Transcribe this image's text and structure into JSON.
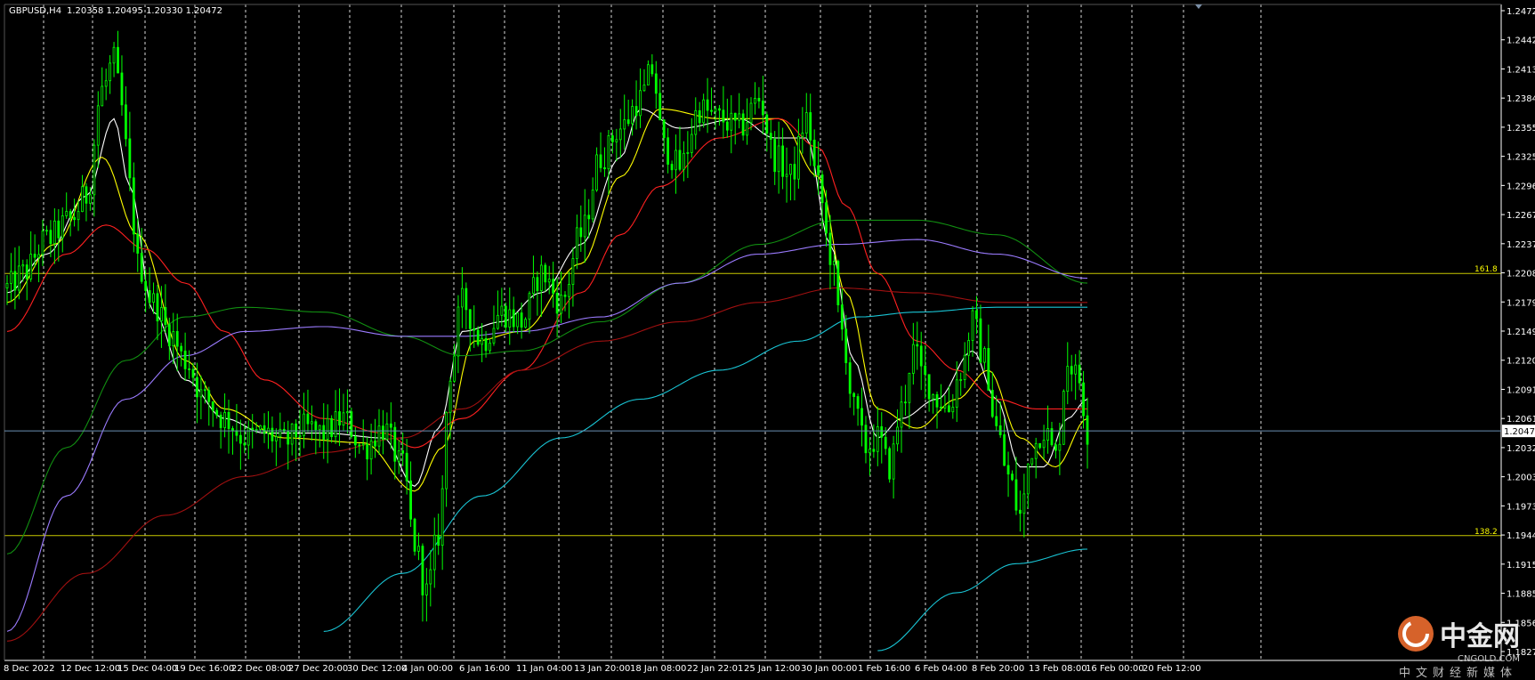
{
  "header": {
    "symbol": "GBPUSD,H4",
    "ohlc": "1.20358 1.20495 1.20330 1.20472"
  },
  "fib_levels": [
    {
      "label": "161.8",
      "price": 1.221
    },
    {
      "label": "138.2",
      "price": 1.1939
    }
  ],
  "current_price": {
    "label": "1.20472",
    "value": 1.20472
  },
  "logo": {
    "cn": "中金网",
    "en": "CNGOLD.COM",
    "sub": "中文财经新媒体"
  },
  "colors": {
    "background": "#000000",
    "candle": "#00ff00",
    "grid": "#ffffff",
    "axis": "#ffffff",
    "fib": "#c8c800",
    "current_line": "#6b8fb3",
    "ma_white": "#ffffff",
    "ma_yellow": "#ffff00",
    "ma_red": "#ff2020",
    "ma_darkred": "#a01010",
    "ma_green": "#118f11",
    "ma_purple": "#9b7bff",
    "ma_cyan": "#19c4d4"
  },
  "chart_data": {
    "type": "candlestick",
    "title": "GBPUSD,H4",
    "ylim": [
      1.181,
      1.2488
    ],
    "y_ticks": [
      "1.24720",
      "1.24425",
      "1.24130",
      "1.23840",
      "1.23550",
      "1.23255",
      "1.22960",
      "1.22670",
      "1.22375",
      "1.22080",
      "1.21790",
      "1.21495",
      "1.21200",
      "1.20910",
      "1.20615",
      "1.20323",
      "1.20030",
      "1.19735",
      "1.19445",
      "1.19150",
      "1.18855",
      "1.18565",
      "1.18270"
    ],
    "x_ticks": [
      "8 Dec 2022",
      "12 Dec 12:00",
      "15 Dec 04:00",
      "19 Dec 16:00",
      "22 Dec 08:00",
      "27 Dec 20:00",
      "30 Dec 12:00",
      "4 Jan 00:00",
      "6 Jan 16:00",
      "11 Jan 04:00",
      "13 Jan 20:00",
      "18 Jan 08:00",
      "22 Jan 22:01",
      "25 Jan 12:00",
      "30 Jan 00:00",
      "1 Feb 16:00",
      "6 Feb 04:00",
      "8 Feb 20:00",
      "13 Feb 08:00",
      "16 Feb 00:00",
      "20 Feb 12:00"
    ],
    "grid": true,
    "series_price_path": {
      "description_values": "approximate close anchors per bar index",
      "anchors": [
        [
          0,
          1.2195
        ],
        [
          4,
          1.221
        ],
        [
          10,
          1.2245
        ],
        [
          16,
          1.2265
        ],
        [
          20,
          1.229
        ],
        [
          24,
          1.24
        ],
        [
          27,
          1.243
        ],
        [
          29,
          1.238
        ],
        [
          31,
          1.23
        ],
        [
          33,
          1.222
        ],
        [
          37,
          1.218
        ],
        [
          41,
          1.215
        ],
        [
          45,
          1.212
        ],
        [
          50,
          1.208
        ],
        [
          55,
          1.206
        ],
        [
          60,
          1.204
        ],
        [
          65,
          1.2045
        ],
        [
          70,
          1.2035
        ],
        [
          75,
          1.205
        ],
        [
          80,
          1.2045
        ],
        [
          85,
          1.206
        ],
        [
          90,
          1.203
        ],
        [
          95,
          1.205
        ],
        [
          100,
          1.201
        ],
        [
          103,
          1.193
        ],
        [
          106,
          1.188
        ],
        [
          109,
          1.194
        ],
        [
          112,
          1.211
        ],
        [
          115,
          1.218
        ],
        [
          120,
          1.214
        ],
        [
          125,
          1.217
        ],
        [
          130,
          1.216
        ],
        [
          135,
          1.221
        ],
        [
          140,
          1.218
        ],
        [
          145,
          1.225
        ],
        [
          150,
          1.233
        ],
        [
          155,
          1.236
        ],
        [
          160,
          1.239
        ],
        [
          163,
          1.242
        ],
        [
          166,
          1.234
        ],
        [
          170,
          1.232
        ],
        [
          175,
          1.238
        ],
        [
          180,
          1.237
        ],
        [
          185,
          1.236
        ],
        [
          190,
          1.239
        ],
        [
          194,
          1.233
        ],
        [
          198,
          1.231
        ],
        [
          202,
          1.237
        ],
        [
          205,
          1.23
        ],
        [
          208,
          1.223
        ],
        [
          211,
          1.215
        ],
        [
          214,
          1.207
        ],
        [
          217,
          1.203
        ],
        [
          220,
          1.204
        ],
        [
          223,
          1.201
        ],
        [
          226,
          1.207
        ],
        [
          229,
          1.213
        ],
        [
          232,
          1.21
        ],
        [
          235,
          1.208
        ],
        [
          238,
          1.207
        ],
        [
          241,
          1.211
        ],
        [
          244,
          1.216
        ],
        [
          247,
          1.212
        ],
        [
          250,
          1.205
        ],
        [
          253,
          1.2
        ],
        [
          256,
          1.196
        ],
        [
          259,
          1.203
        ],
        [
          262,
          1.205
        ],
        [
          265,
          1.202
        ],
        [
          268,
          1.212
        ],
        [
          271,
          1.21
        ],
        [
          273,
          1.2047
        ]
      ]
    },
    "moving_averages": [
      {
        "color_key": "ma_white",
        "anchors": [
          [
            0,
            1.219
          ],
          [
            10,
            1.223
          ],
          [
            20,
            1.229
          ],
          [
            27,
            1.237
          ],
          [
            31,
            1.23
          ],
          [
            37,
            1.217
          ],
          [
            45,
            1.21
          ],
          [
            55,
            1.206
          ],
          [
            65,
            1.2045
          ],
          [
            80,
            1.2045
          ],
          [
            95,
            1.204
          ],
          [
            103,
            1.199
          ],
          [
            109,
            1.205
          ],
          [
            115,
            1.215
          ],
          [
            125,
            1.216
          ],
          [
            135,
            1.219
          ],
          [
            145,
            1.224
          ],
          [
            155,
            1.233
          ],
          [
            160,
            1.238
          ],
          [
            170,
            1.236
          ],
          [
            185,
            1.237
          ],
          [
            194,
            1.235
          ],
          [
            202,
            1.235
          ],
          [
            208,
            1.224
          ],
          [
            214,
            1.212
          ],
          [
            220,
            1.204
          ],
          [
            226,
            1.206
          ],
          [
            235,
            1.208
          ],
          [
            244,
            1.213
          ],
          [
            250,
            1.208
          ],
          [
            256,
            1.201
          ],
          [
            262,
            1.201
          ],
          [
            268,
            1.206
          ],
          [
            273,
            1.208
          ]
        ]
      },
      {
        "color_key": "ma_yellow",
        "anchors": [
          [
            0,
            1.218
          ],
          [
            12,
            1.224
          ],
          [
            24,
            1.233
          ],
          [
            33,
            1.225
          ],
          [
            45,
            1.212
          ],
          [
            55,
            1.207
          ],
          [
            70,
            1.204
          ],
          [
            90,
            1.2035
          ],
          [
            103,
            1.1985
          ],
          [
            110,
            1.203
          ],
          [
            118,
            1.214
          ],
          [
            130,
            1.215
          ],
          [
            145,
            1.222
          ],
          [
            155,
            1.231
          ],
          [
            165,
            1.238
          ],
          [
            180,
            1.237
          ],
          [
            195,
            1.237
          ],
          [
            205,
            1.231
          ],
          [
            212,
            1.219
          ],
          [
            220,
            1.207
          ],
          [
            230,
            1.205
          ],
          [
            240,
            1.208
          ],
          [
            248,
            1.211
          ],
          [
            256,
            1.204
          ],
          [
            265,
            1.201
          ],
          [
            273,
            1.206
          ]
        ]
      },
      {
        "color_key": "ma_red",
        "anchors": [
          [
            0,
            1.215
          ],
          [
            15,
            1.223
          ],
          [
            25,
            1.226
          ],
          [
            35,
            1.2235
          ],
          [
            45,
            1.22
          ],
          [
            55,
            1.215
          ],
          [
            65,
            1.21
          ],
          [
            80,
            1.206
          ],
          [
            95,
            1.2045
          ],
          [
            103,
            1.203
          ],
          [
            115,
            1.206
          ],
          [
            130,
            1.211
          ],
          [
            145,
            1.219
          ],
          [
            155,
            1.225
          ],
          [
            165,
            1.23
          ],
          [
            180,
            1.235
          ],
          [
            195,
            1.237
          ],
          [
            205,
            1.234
          ],
          [
            212,
            1.228
          ],
          [
            220,
            1.221
          ],
          [
            230,
            1.214
          ],
          [
            240,
            1.211
          ],
          [
            250,
            1.208
          ],
          [
            260,
            1.207
          ],
          [
            273,
            1.207
          ]
        ]
      },
      {
        "color_key": "ma_darkred",
        "anchors": [
          [
            0,
            1.183
          ],
          [
            20,
            1.19
          ],
          [
            40,
            1.196
          ],
          [
            60,
            1.2
          ],
          [
            80,
            1.2025
          ],
          [
            100,
            1.204
          ],
          [
            115,
            1.207
          ],
          [
            130,
            1.211
          ],
          [
            150,
            1.214
          ],
          [
            170,
            1.216
          ],
          [
            190,
            1.218
          ],
          [
            210,
            1.2195
          ],
          [
            230,
            1.219
          ],
          [
            250,
            1.218
          ],
          [
            273,
            1.218
          ]
        ]
      },
      {
        "color_key": "ma_green",
        "anchors": [
          [
            0,
            1.192
          ],
          [
            15,
            1.203
          ],
          [
            30,
            1.212
          ],
          [
            45,
            1.2165
          ],
          [
            60,
            1.2175
          ],
          [
            80,
            1.217
          ],
          [
            100,
            1.2145
          ],
          [
            115,
            1.2125
          ],
          [
            130,
            1.213
          ],
          [
            150,
            1.216
          ],
          [
            170,
            1.22
          ],
          [
            190,
            1.224
          ],
          [
            210,
            1.2265
          ],
          [
            230,
            1.2265
          ],
          [
            250,
            1.225
          ],
          [
            273,
            1.22
          ]
        ]
      },
      {
        "color_key": "ma_purple",
        "anchors": [
          [
            0,
            1.184
          ],
          [
            15,
            1.198
          ],
          [
            30,
            1.208
          ],
          [
            45,
            1.2125
          ],
          [
            60,
            1.215
          ],
          [
            80,
            1.2155
          ],
          [
            100,
            1.2145
          ],
          [
            115,
            1.2145
          ],
          [
            130,
            1.215
          ],
          [
            150,
            1.2165
          ],
          [
            170,
            1.22
          ],
          [
            190,
            1.223
          ],
          [
            210,
            1.224
          ],
          [
            230,
            1.2245
          ],
          [
            250,
            1.223
          ],
          [
            273,
            1.2205
          ]
        ]
      },
      {
        "color_key": "ma_cyan",
        "anchors": [
          [
            80,
            1.184
          ],
          [
            100,
            1.19
          ],
          [
            120,
            1.198
          ],
          [
            140,
            1.204
          ],
          [
            160,
            1.208
          ],
          [
            180,
            1.211
          ],
          [
            200,
            1.214
          ],
          [
            215,
            1.2165
          ],
          [
            230,
            1.217
          ],
          [
            250,
            1.2175
          ],
          [
            273,
            1.2175
          ]
        ],
        "segment2": [
          [
            220,
            1.182
          ],
          [
            240,
            1.188
          ],
          [
            255,
            1.191
          ],
          [
            273,
            1.1925
          ]
        ]
      }
    ]
  }
}
